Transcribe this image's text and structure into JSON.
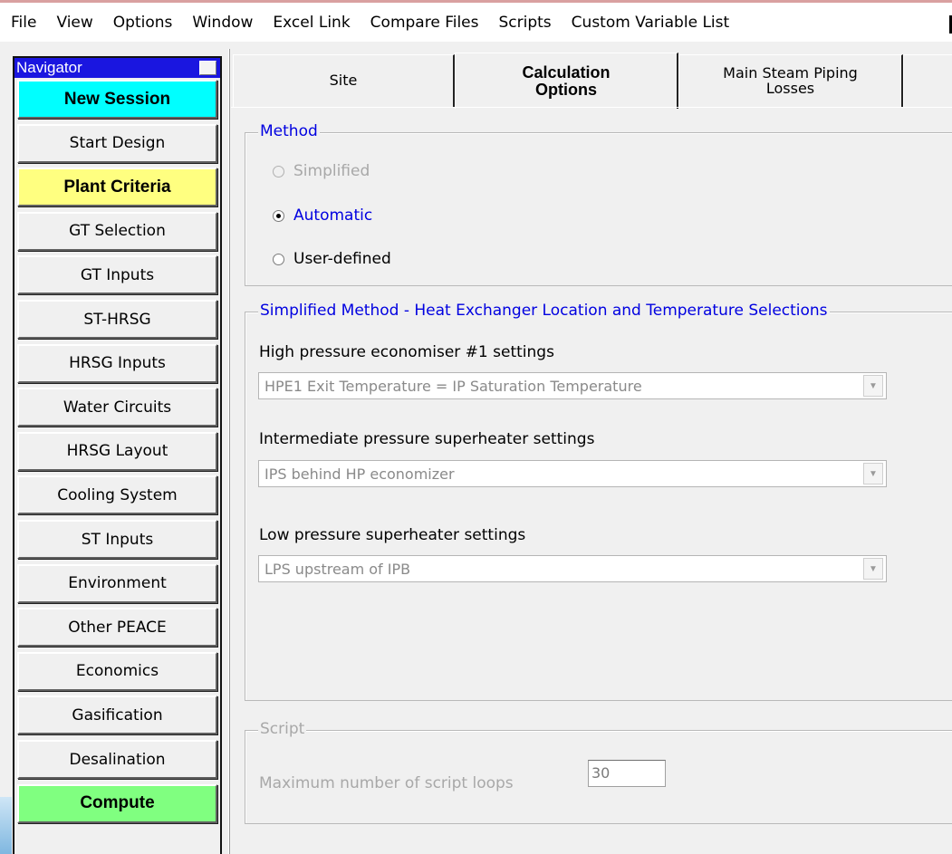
{
  "menu": [
    "File",
    "View",
    "Options",
    "Window",
    "Excel Link",
    "Compare Files",
    "Scripts",
    "Custom Variable List"
  ],
  "navigator": {
    "title": "Navigator",
    "buttons": [
      {
        "label": "New Session",
        "color": "#00ffff",
        "bold": true
      },
      {
        "label": "Start Design",
        "color": "#f0f0f0",
        "bold": false
      },
      {
        "label": "Plant Criteria",
        "color": "#ffff80",
        "bold": true
      },
      {
        "label": "GT Selection",
        "color": "#f0f0f0",
        "bold": false
      },
      {
        "label": "GT Inputs",
        "color": "#f0f0f0",
        "bold": false
      },
      {
        "label": "ST-HRSG",
        "color": "#f0f0f0",
        "bold": false
      },
      {
        "label": "HRSG Inputs",
        "color": "#f0f0f0",
        "bold": false
      },
      {
        "label": "Water Circuits",
        "color": "#f0f0f0",
        "bold": false
      },
      {
        "label": "HRSG Layout",
        "color": "#f0f0f0",
        "bold": false
      },
      {
        "label": "Cooling System",
        "color": "#f0f0f0",
        "bold": false
      },
      {
        "label": "ST Inputs",
        "color": "#f0f0f0",
        "bold": false
      },
      {
        "label": "Environment",
        "color": "#f0f0f0",
        "bold": false
      },
      {
        "label": "Other PEACE",
        "color": "#f0f0f0",
        "bold": false
      },
      {
        "label": "Economics",
        "color": "#f0f0f0",
        "bold": false
      },
      {
        "label": "Gasification",
        "color": "#f0f0f0",
        "bold": false
      },
      {
        "label": "Desalination",
        "color": "#f0f0f0",
        "bold": false
      },
      {
        "label": "Compute",
        "color": "#80ff80",
        "bold": true
      }
    ]
  },
  "tabs": [
    {
      "label": "Site",
      "active": false
    },
    {
      "label": "Calculation Options",
      "active": true
    },
    {
      "label": "Main Steam Piping Losses",
      "active": false
    }
  ],
  "method": {
    "legend": "Method",
    "options": [
      {
        "label": "Simplified",
        "checked": false,
        "disabled": true
      },
      {
        "label": "Automatic",
        "checked": true,
        "disabled": false
      },
      {
        "label": "User-defined",
        "checked": false,
        "disabled": false
      }
    ]
  },
  "simplified": {
    "legend": "Simplified Method -  Heat Exchanger Location and Temperature Selections",
    "fields": [
      {
        "label": "High pressure economiser #1 settings",
        "value": "HPE1 Exit Temperature = IP Saturation Temperature"
      },
      {
        "label": "Intermediate pressure superheater settings",
        "value": "IPS behind HP economizer"
      },
      {
        "label": "Low pressure superheater settings",
        "value": "LPS upstream of IPB"
      }
    ]
  },
  "script": {
    "legend": "Script",
    "loops_label": "Maximum number of script loops",
    "loops_value": "30"
  },
  "colors": {
    "navigator_title": "#1a16e0",
    "legend_blue": "#0000e0"
  }
}
